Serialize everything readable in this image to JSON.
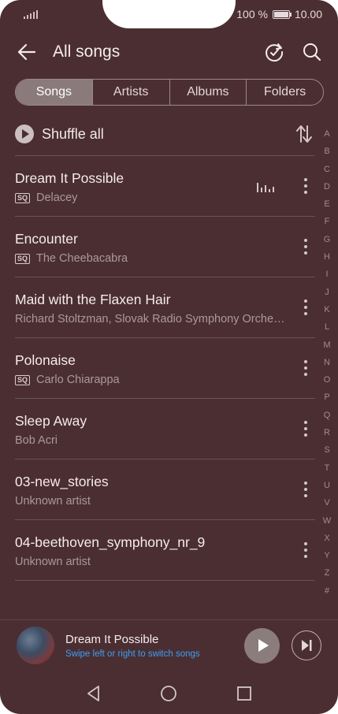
{
  "status": {
    "battery": "100 %",
    "time": "10.00"
  },
  "header": {
    "title": "All songs",
    "icons": [
      "back-arrow-icon",
      "refresh-icon",
      "search-icon"
    ]
  },
  "tabs": [
    "Songs",
    "Artists",
    "Albums",
    "Folders"
  ],
  "shuffle": {
    "label": "Shuffle all"
  },
  "index": [
    "A",
    "B",
    "C",
    "D",
    "E",
    "F",
    "G",
    "H",
    "I",
    "J",
    "K",
    "L",
    "M",
    "N",
    "O",
    "P",
    "Q",
    "R",
    "S",
    "T",
    "U",
    "V",
    "W",
    "X",
    "Y",
    "Z",
    "#"
  ],
  "songs": [
    {
      "title": "Dream It Possible",
      "artist": "Delacey",
      "sq": "SQ",
      "playing": true
    },
    {
      "title": "Encounter",
      "artist": "The Cheebacabra",
      "sq": "SQ"
    },
    {
      "title": "Maid with the Flaxen Hair",
      "artist": "Richard Stoltzman, Slovak Radio Symphony Orche…"
    },
    {
      "title": "Polonaise",
      "artist": "Carlo Chiarappa",
      "sq": "SQ"
    },
    {
      "title": "Sleep Away",
      "artist": "Bob Acri"
    },
    {
      "title": "03-new_stories",
      "artist": "Unknown artist"
    },
    {
      "title": "04-beethoven_symphony_nr_9",
      "artist": "Unknown artist"
    }
  ],
  "player": {
    "title": "Dream It Possible",
    "hint": "Swipe left or right to switch songs"
  },
  "colors": {
    "background": "#4b2e32",
    "accent": "#3aa0f5"
  }
}
